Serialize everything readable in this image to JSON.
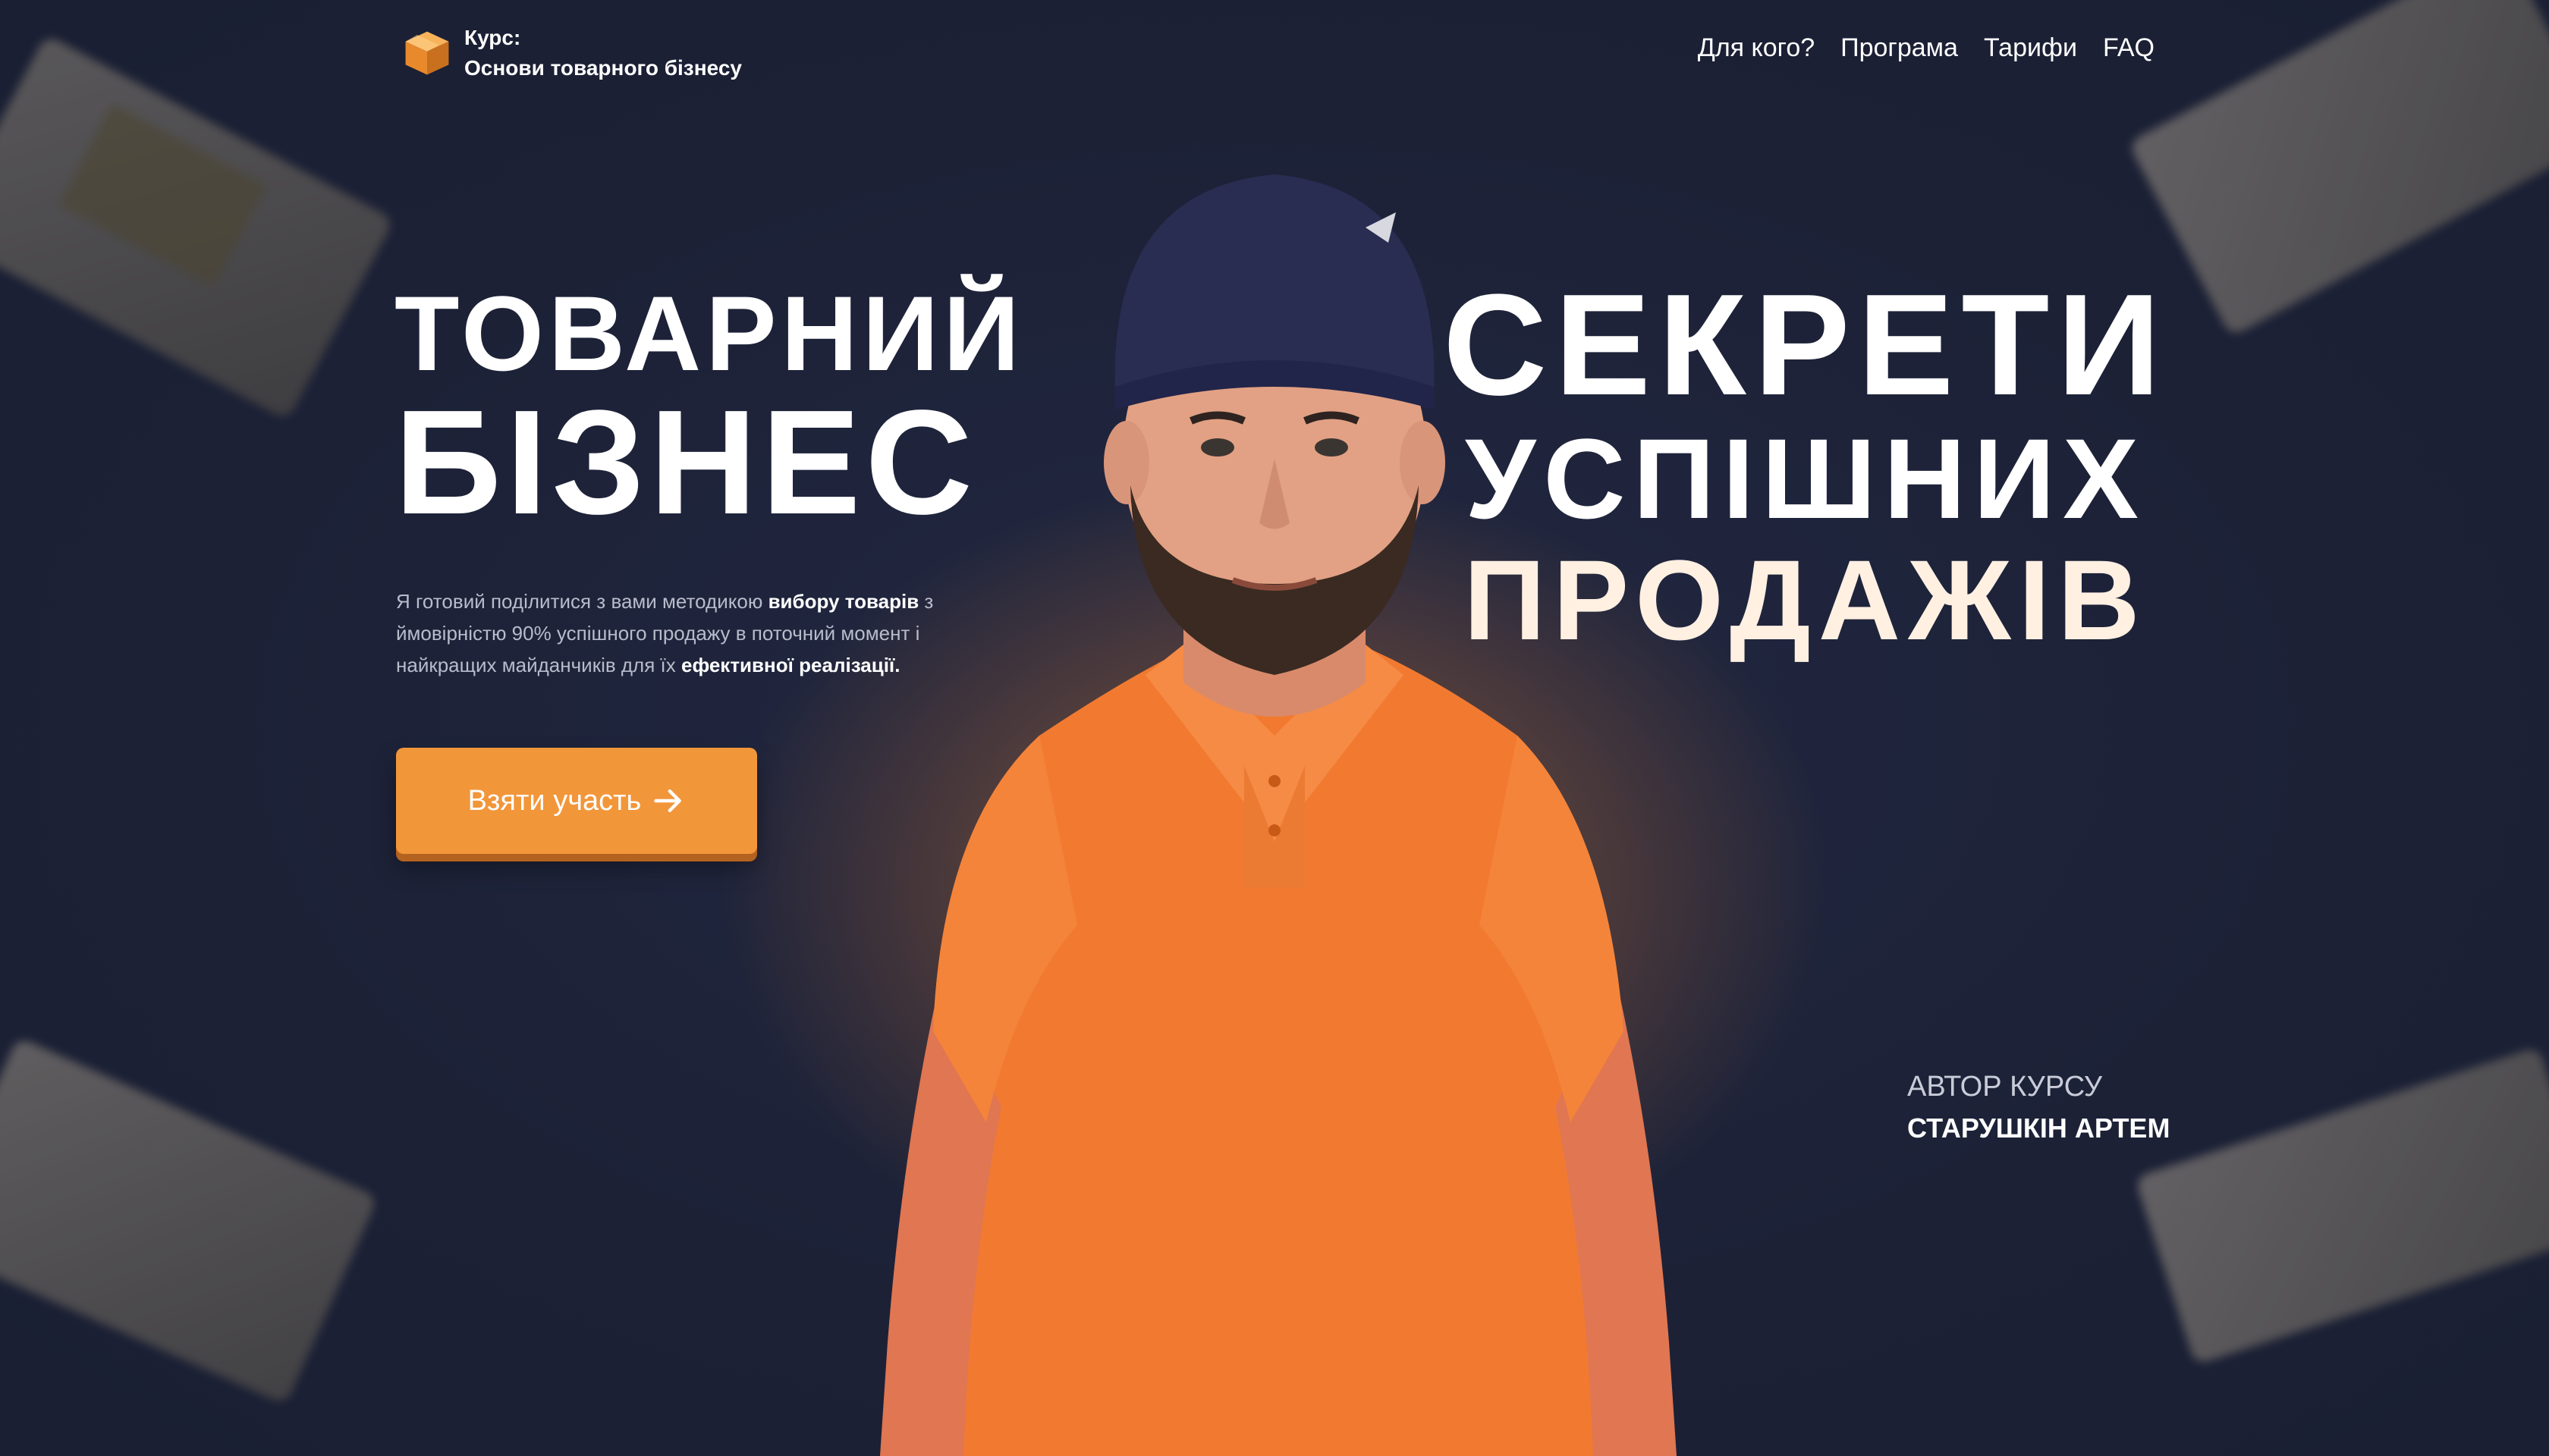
{
  "brand": {
    "line1": "Курс:",
    "line2": "Основи товарного бізнесу",
    "icon": "box-icon",
    "accent": "#f2963a"
  },
  "nav": {
    "items": [
      "Для кого?",
      "Програма",
      "Тарифи",
      "FAQ"
    ]
  },
  "hero": {
    "title_line1": "ТОВАРНИЙ",
    "title_line2": "БІЗНЕС",
    "desc_part1": "Я готовий поділитися з вами методикою ",
    "desc_bold1": "вибору товарів",
    "desc_part2": " з ймовірністю 90% успішного продажу в поточний момент і найкращих майданчиків для їх ",
    "desc_bold2": "ефективної реалізації.",
    "cta_label": "Взяти участь",
    "cta_icon": "arrow-right-icon"
  },
  "secrets": {
    "line1": "СЕКРЕТИ",
    "line2": "УСПІШНИХ",
    "line3": "ПРОДАЖІВ"
  },
  "author": {
    "caption": "АВТОР КУРСУ",
    "name": "СТАРУШКІН АРТЕМ"
  },
  "colors": {
    "background": "#1c2136",
    "shirt": "#f27a30",
    "cap": "#2a2d52"
  }
}
